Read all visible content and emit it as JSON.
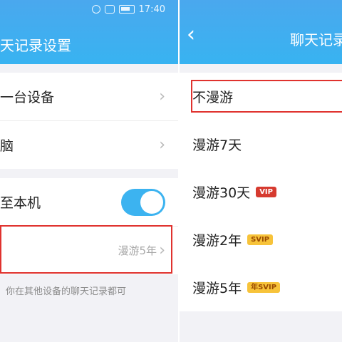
{
  "left": {
    "status": {
      "time": "17:40"
    },
    "header": {
      "title": "天记录设置"
    },
    "items": [
      {
        "label": "一台设备"
      },
      {
        "label": "脑"
      }
    ],
    "toggle_row": {
      "label": "至本机",
      "on": true
    },
    "roam_row": {
      "value": "漫游5年"
    },
    "hint": "你在其他设备的聊天记录都可"
  },
  "right": {
    "header": {
      "title": "聊天记录"
    },
    "options": [
      {
        "label": "不漫游",
        "badge": ""
      },
      {
        "label": "漫游7天",
        "badge": ""
      },
      {
        "label": "漫游30天",
        "badge": "VIP"
      },
      {
        "label": "漫游2年",
        "badge": "SVIP"
      },
      {
        "label": "漫游5年",
        "badge": "年SVIP"
      }
    ]
  },
  "colors": {
    "header": "#3ab0f0",
    "highlight_box": "#e0322e",
    "vip_badge": "#d63a2f",
    "svip_badge": "#f7c33a"
  },
  "icons": {
    "chevron": "chevron-right-icon",
    "back": "back-arrow-icon"
  }
}
